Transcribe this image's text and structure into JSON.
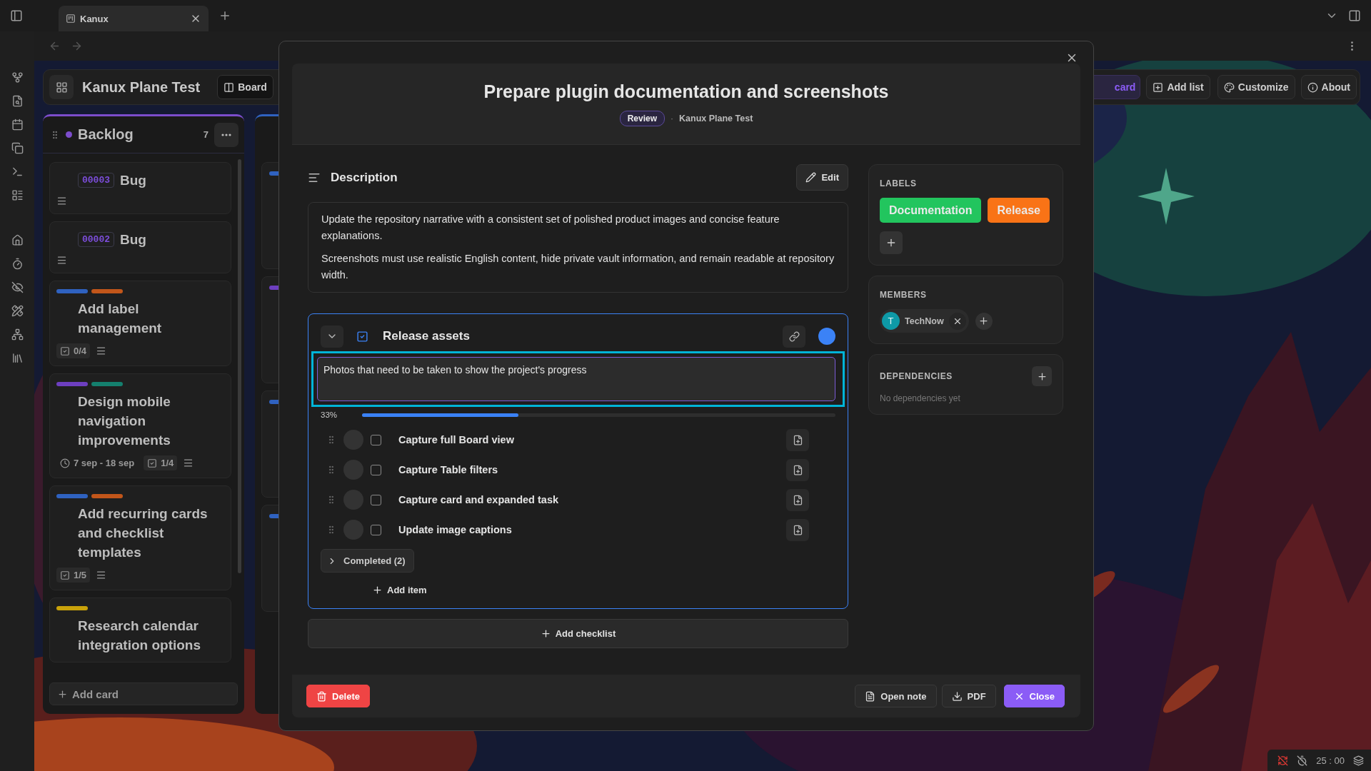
{
  "browser_tab": {
    "title": "Kanux"
  },
  "board": {
    "title": "Kanux Plane Test",
    "view_button": "Board",
    "actions": [
      {
        "kind": "accent",
        "label": "card"
      },
      {
        "kind": "add",
        "label": "Add list"
      },
      {
        "kind": "palette",
        "label": "Customize"
      },
      {
        "kind": "info",
        "label": "About"
      }
    ]
  },
  "columns": [
    {
      "title": "Backlog",
      "color": "#7c4dcc",
      "count": "7",
      "add_card": "Add card",
      "cards": [
        {
          "id": "00003",
          "title": "Bug",
          "has_description": true
        },
        {
          "id": "00002",
          "title": "Bug",
          "has_description": true
        },
        {
          "title": "Add label management",
          "labels": [
            {
              "color": "#2f62c0"
            },
            {
              "color": "#c2561a"
            }
          ],
          "checklist": "0/4",
          "has_description": true
        },
        {
          "title": "Design mobile navigation improvements",
          "labels": [
            {
              "color": "#6d3fc0"
            },
            {
              "color": "#14806e"
            }
          ],
          "dates": "7 sep - 18 sep",
          "checklist": "1/4",
          "has_description": true
        },
        {
          "title": "Add recurring cards and checklist templates",
          "labels": [
            {
              "color": "#2f62c0"
            },
            {
              "color": "#c2561a"
            }
          ],
          "checklist": "1/5",
          "has_description": true
        },
        {
          "title": "Research calendar integration options",
          "labels": [
            {
              "color": "#c9a20a"
            }
          ],
          "has_description": false
        }
      ]
    },
    {
      "color": "#2f62c0",
      "cards": [
        {
          "labels": [
            {
              "color": "#2f62c0"
            }
          ]
        },
        {
          "labels": [
            {
              "color": "#6d3fc0"
            }
          ]
        },
        {
          "labels": [
            {
              "color": "#2f62c0"
            }
          ]
        },
        {
          "labels": [
            {
              "color": "#2f62c0"
            }
          ]
        }
      ]
    }
  ],
  "task": {
    "title": "Prepare plugin documentation and screenshots",
    "status": "Review",
    "separator": "·",
    "board": "Kanux Plane Test",
    "description": {
      "heading": "Description",
      "edit": "Edit",
      "paragraphs": [
        "Update the repository narrative with a consistent set of polished product images and concise feature explanations.",
        "Screenshots must use realistic English content, hide private vault information, and remain readable at repository width."
      ]
    },
    "checklist": {
      "title": "Release assets",
      "color": "#3b82f6",
      "note": "Photos that need to be taken to show the project's progress",
      "progress": "33%",
      "level": 0.33,
      "items": [
        {
          "text": "Capture full Board view",
          "checked": false
        },
        {
          "text": "Capture Table filters",
          "checked": false
        },
        {
          "text": "Capture card and expanded task",
          "checked": false
        },
        {
          "text": "Update image captions",
          "checked": false
        }
      ],
      "completed": {
        "label": "Completed (2)",
        "expanded": false
      },
      "add_item": "Add item"
    },
    "add_checklist": "Add checklist",
    "labels": {
      "heading": "LABELS",
      "items": [
        {
          "name": "Documentation",
          "color": "#22c55e"
        },
        {
          "name": "Release",
          "color": "#f97316"
        }
      ]
    },
    "members": {
      "heading": "MEMBERS",
      "items": [
        {
          "initial": "T",
          "name": "TechNow"
        }
      ]
    },
    "dependencies": {
      "heading": "DEPENDENCIES",
      "empty": "No dependencies yet"
    },
    "footer": {
      "delete": "Delete",
      "open_note": "Open note",
      "pdf": "PDF",
      "close": "Close"
    }
  },
  "status_bar": {
    "timer": "25 : 00"
  }
}
